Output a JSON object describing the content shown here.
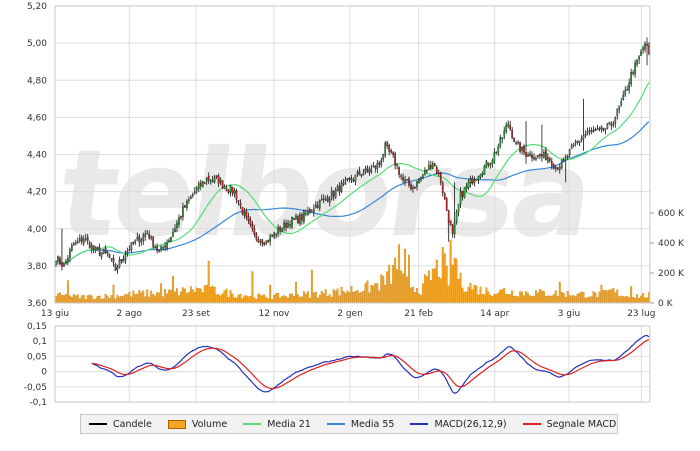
{
  "chart_data": {
    "type": "candlestick",
    "watermark": "telborsa",
    "x_tick_labels": [
      "13 giu",
      "2 ago",
      "23 set",
      "12 nov",
      "2 gen",
      "21 feb",
      "14 apr",
      "3 giu",
      "23 lug"
    ],
    "price_axis": {
      "ylim": [
        3.6,
        5.2
      ],
      "tick_labels": [
        "5,20",
        "5,00",
        "4,80",
        "4,60",
        "4,40",
        "4,20",
        "4,00",
        "3,80",
        "3,60"
      ]
    },
    "volume_axis": {
      "ylim": [
        0,
        600000
      ],
      "tick_labels": [
        "600 K",
        "400 K",
        "200 K",
        "0 K"
      ]
    },
    "macd_axis": {
      "ylim": [
        -0.1,
        0.15
      ],
      "tick_labels": [
        "0,15",
        "0,1",
        "0,05",
        "0",
        "-0,05",
        "-0,1"
      ]
    },
    "close_anchors": [
      [
        0,
        3.84
      ],
      [
        4,
        3.8
      ],
      [
        8,
        3.9
      ],
      [
        14,
        3.95
      ],
      [
        20,
        3.88
      ],
      [
        26,
        3.86
      ],
      [
        30,
        3.78
      ],
      [
        35,
        3.87
      ],
      [
        40,
        3.93
      ],
      [
        46,
        3.98
      ],
      [
        52,
        3.87
      ],
      [
        58,
        3.96
      ],
      [
        64,
        4.1
      ],
      [
        70,
        4.2
      ],
      [
        76,
        4.27
      ],
      [
        82,
        4.26
      ],
      [
        86,
        4.22
      ],
      [
        90,
        4.2
      ],
      [
        95,
        4.07
      ],
      [
        100,
        3.96
      ],
      [
        106,
        3.93
      ],
      [
        112,
        3.99
      ],
      [
        118,
        4.04
      ],
      [
        124,
        4.06
      ],
      [
        130,
        4.12
      ],
      [
        136,
        4.16
      ],
      [
        142,
        4.21
      ],
      [
        148,
        4.26
      ],
      [
        154,
        4.3
      ],
      [
        158,
        4.31
      ],
      [
        163,
        4.35
      ],
      [
        166,
        4.44
      ],
      [
        170,
        4.38
      ],
      [
        175,
        4.26
      ],
      [
        180,
        4.22
      ],
      [
        185,
        4.29
      ],
      [
        190,
        4.36
      ],
      [
        194,
        4.26
      ],
      [
        197,
        4.1
      ],
      [
        200,
        3.96
      ],
      [
        204,
        4.18
      ],
      [
        208,
        4.24
      ],
      [
        214,
        4.31
      ],
      [
        220,
        4.38
      ],
      [
        224,
        4.47
      ],
      [
        228,
        4.57
      ],
      [
        232,
        4.45
      ],
      [
        236,
        4.41
      ],
      [
        242,
        4.39
      ],
      [
        248,
        4.39
      ],
      [
        252,
        4.33
      ],
      [
        256,
        4.36
      ],
      [
        262,
        4.46
      ],
      [
        268,
        4.52
      ],
      [
        274,
        4.52
      ],
      [
        280,
        4.56
      ],
      [
        286,
        4.7
      ],
      [
        290,
        4.83
      ],
      [
        294,
        4.92
      ],
      [
        297,
        5.0
      ],
      [
        299,
        4.94
      ]
    ],
    "volume_anchors": [
      [
        0,
        50
      ],
      [
        12,
        40
      ],
      [
        25,
        45
      ],
      [
        40,
        60
      ],
      [
        60,
        70
      ],
      [
        70,
        90
      ],
      [
        80,
        80
      ],
      [
        90,
        60
      ],
      [
        105,
        40
      ],
      [
        120,
        50
      ],
      [
        140,
        70
      ],
      [
        150,
        90
      ],
      [
        160,
        110
      ],
      [
        166,
        150
      ],
      [
        172,
        240
      ],
      [
        175,
        140
      ],
      [
        185,
        90
      ],
      [
        190,
        200
      ],
      [
        195,
        260
      ],
      [
        198,
        160
      ],
      [
        201,
        320
      ],
      [
        204,
        140
      ],
      [
        215,
        80
      ],
      [
        235,
        70
      ],
      [
        260,
        60
      ],
      [
        275,
        55
      ],
      [
        280,
        80
      ],
      [
        288,
        45
      ],
      [
        299,
        50
      ]
    ],
    "volume_spikes": [
      [
        6,
        150
      ],
      [
        29,
        120
      ],
      [
        53,
        130
      ],
      [
        59,
        180
      ],
      [
        77,
        280
      ],
      [
        99,
        210
      ],
      [
        108,
        120
      ],
      [
        121,
        140
      ],
      [
        129,
        220
      ],
      [
        140,
        90
      ],
      [
        156,
        130
      ],
      [
        162,
        130
      ],
      [
        171,
        300
      ],
      [
        173,
        390
      ],
      [
        176,
        360
      ],
      [
        178,
        320
      ],
      [
        186,
        190
      ],
      [
        196,
        330
      ],
      [
        199,
        420
      ],
      [
        201,
        300
      ],
      [
        226,
        100
      ],
      [
        254,
        140
      ],
      [
        263,
        60
      ],
      [
        275,
        120
      ],
      [
        290,
        110
      ]
    ],
    "legend": [
      {
        "label": "Candele",
        "color": "#000000",
        "kind": "line"
      },
      {
        "label": "Volume",
        "color": "#f5a623",
        "kind": "box"
      },
      {
        "label": "Media 21",
        "color": "#55dd77",
        "kind": "line"
      },
      {
        "label": "Media 55",
        "color": "#3a88d8",
        "kind": "line"
      },
      {
        "label": "MACD(26,12,9)",
        "color": "#2233bb",
        "kind": "line"
      },
      {
        "label": "Segnale MACD",
        "color": "#dd2222",
        "kind": "line"
      }
    ],
    "colors": {
      "up": "#2a9d3a",
      "down": "#c0262c",
      "wick": "#111111",
      "volume": "#f5a623",
      "volume_edge": "#c77800",
      "grid": "#dddddd",
      "frame": "#c8c8c8"
    }
  }
}
